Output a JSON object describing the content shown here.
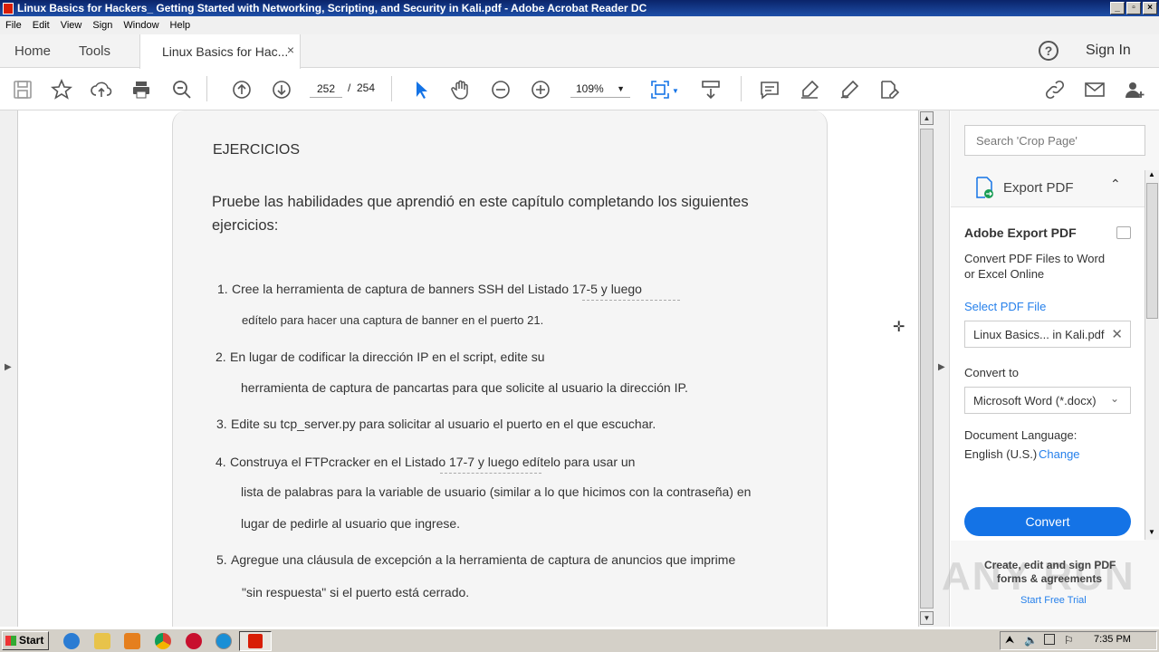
{
  "window": {
    "title": "Linux Basics for Hackers_ Getting Started with Networking, Scripting, and Security in Kali.pdf - Adobe Acrobat Reader DC",
    "min": "_",
    "max": "▫",
    "close": "×"
  },
  "menu": [
    "File",
    "Edit",
    "View",
    "Sign",
    "Window",
    "Help"
  ],
  "tabs": {
    "home": "Home",
    "tools": "Tools",
    "doc": "Linux Basics for Hac...",
    "close": "×",
    "help": "?",
    "signin": "Sign In"
  },
  "toolbar": {
    "page_current": "252",
    "page_sep": "/",
    "page_total": "254",
    "zoom": "109%",
    "icons": [
      "save-icon",
      "bookmark-star-icon",
      "upload-icon",
      "print-icon",
      "find-icon",
      "page-up-icon",
      "page-down-icon",
      "select-pointer-icon",
      "hand-icon",
      "zoom-out-icon",
      "zoom-in-icon",
      "fit-page-icon",
      "scroll-mode-icon",
      "comment-icon",
      "highlight-icon",
      "sign-icon",
      "fill-sign-icon",
      "link-icon",
      "email-icon",
      "add-user-icon"
    ]
  },
  "document": {
    "heading": "EJERCICIOS",
    "intro_1": "Pruebe las habilidades que aprendió en este capítulo completando los siguientes",
    "intro_2": "ejercicios:",
    "items": [
      {
        "n": "1.",
        "line1": "Cree la herramienta de captura de banners SSH del Listado 17-5 y luego",
        "line2": "edítelo para hacer una captura de banner en el puerto 21."
      },
      {
        "n": "2.",
        "line1": "En lugar de codificar la dirección IP en el script, edite su",
        "line2": "herramienta de captura de pancartas para que solicite al usuario la dirección IP."
      },
      {
        "n": "3.",
        "line1": "Edite su tcp_server.py para solicitar al usuario el puerto en el que escuchar.",
        "line2": ""
      },
      {
        "n": "4.",
        "line1": "Construya el FTPcracker en el Listado 17-7 y luego edítelo para usar un",
        "line2": "lista de palabras para la variable de usuario (similar a lo que hicimos con la contraseña) en",
        "line3": "lugar de pedirle al usuario que ingrese."
      },
      {
        "n": "5.",
        "line1": "Agregue una cláusula de excepción a la herramienta de captura de anuncios que imprime",
        "line2": "\"sin respuesta\" si el puerto está cerrado."
      }
    ]
  },
  "right_pane": {
    "search_placeholder": "Search 'Crop Page'",
    "export_title": "Export PDF",
    "panel_title": "Adobe Export PDF",
    "panel_desc_1": "Convert PDF Files to Word",
    "panel_desc_2": "or Excel Online",
    "select_file": "Select PDF File",
    "file_name": "Linux Basics... in Kali.pdf",
    "convert_to_label": "Convert to",
    "convert_to_value": "Microsoft Word (*.docx)",
    "doc_lang_label": "Document Language:",
    "doc_lang_value": "English (U.S.)",
    "change": "Change",
    "convert_button": "Convert",
    "promo_1": "Create, edit and sign PDF",
    "promo_2": "forms & agreements",
    "promo_link": "Start Free Trial",
    "watermark": "ANY RUN"
  },
  "taskbar": {
    "start": "Start",
    "clock": "7:35 PM"
  },
  "colors": {
    "accent": "#1473e6",
    "title_bar": "#0a246a",
    "acrobat_red": "#d81e05"
  }
}
